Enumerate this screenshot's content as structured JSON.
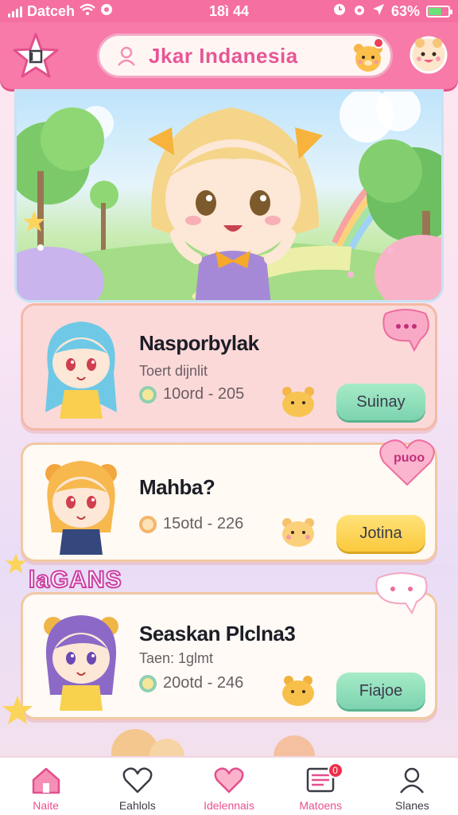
{
  "status_bar": {
    "carrier": "Datceh",
    "time": "18ì 44",
    "battery": "63%"
  },
  "header": {
    "search_title": "Jkar Indanesia"
  },
  "cards": [
    {
      "name": "Nasporbylak",
      "subtitle": "Toert dijnlit",
      "meta": "10ord - 205",
      "button": "Suinay",
      "bubble": ""
    },
    {
      "name": "Mahba?",
      "subtitle": "",
      "meta": "15otd - 226",
      "button": "Jotina",
      "bubble": "puoo"
    },
    {
      "name": "Seaskan Plclna3",
      "subtitle": "Taen: 1glmt",
      "meta": "20otd - 246",
      "button": "Fiajoe",
      "bubble": ""
    }
  ],
  "section_tag": "laGANS",
  "bottom_nav": [
    {
      "label": "Naite",
      "icon": "home-icon"
    },
    {
      "label": "Eahlols",
      "icon": "heart-outline-icon"
    },
    {
      "label": "Idelennais",
      "icon": "heart-filled-icon"
    },
    {
      "label": "Matoens",
      "icon": "messages-icon",
      "badge": "0"
    },
    {
      "label": "Slanes",
      "icon": "profile-icon"
    }
  ],
  "colors": {
    "header": "#f77aa9",
    "accent": "#ea4f8e",
    "green_button": "#7cd3ae",
    "yellow_button": "#fbc93c"
  }
}
